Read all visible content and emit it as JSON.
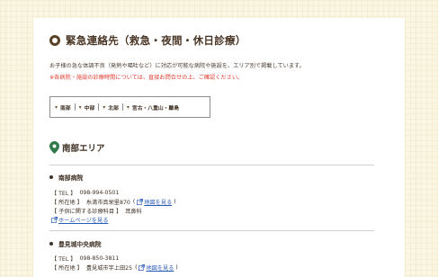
{
  "page": {
    "title": "緊急連絡先（救急・夜間・休日診療）",
    "intro": "お子様の急な体調不良（発熱や嘔吐など）に対応が可能な病院や施設を、エリア別で掲載しています。",
    "notice": "※各病院・施設の診療時間については、直接お問合せの上、ご確認ください。"
  },
  "area_nav": [
    {
      "label": "南部"
    },
    {
      "label": "中部"
    },
    {
      "label": "北部"
    },
    {
      "label": "宮古・八重山・離島"
    }
  ],
  "area": {
    "title": "南部エリア",
    "hospitals": [
      {
        "name": "南部病院",
        "tel_label": "【 TEL 】",
        "tel": "098-994-0501",
        "address_label": "【 所在地 】",
        "address": "糸満市真栄里870",
        "map_link": "地図を見る",
        "dept_label": "【 子供に関する診療科目 】",
        "dept": "耳鼻科",
        "homepage_link": "ホームページを見る"
      },
      {
        "name": "豊見城中央病院",
        "tel_label": "【 TEL 】",
        "tel": "098-850-3811",
        "address_label": "【 所在地 】",
        "address": "豊見城市字上田25",
        "map_link": "地図を見る"
      }
    ]
  },
  "colors": {
    "accent_red": "#e03a2f",
    "link_blue": "#2a5ab8",
    "pin_green": "#2f7a4a",
    "heading_brown": "#4a3524"
  },
  "icons": {
    "title": "ring-icon",
    "area": "map-pin-icon",
    "nav": "chevron-down-icon",
    "link": "external-link-icon"
  }
}
